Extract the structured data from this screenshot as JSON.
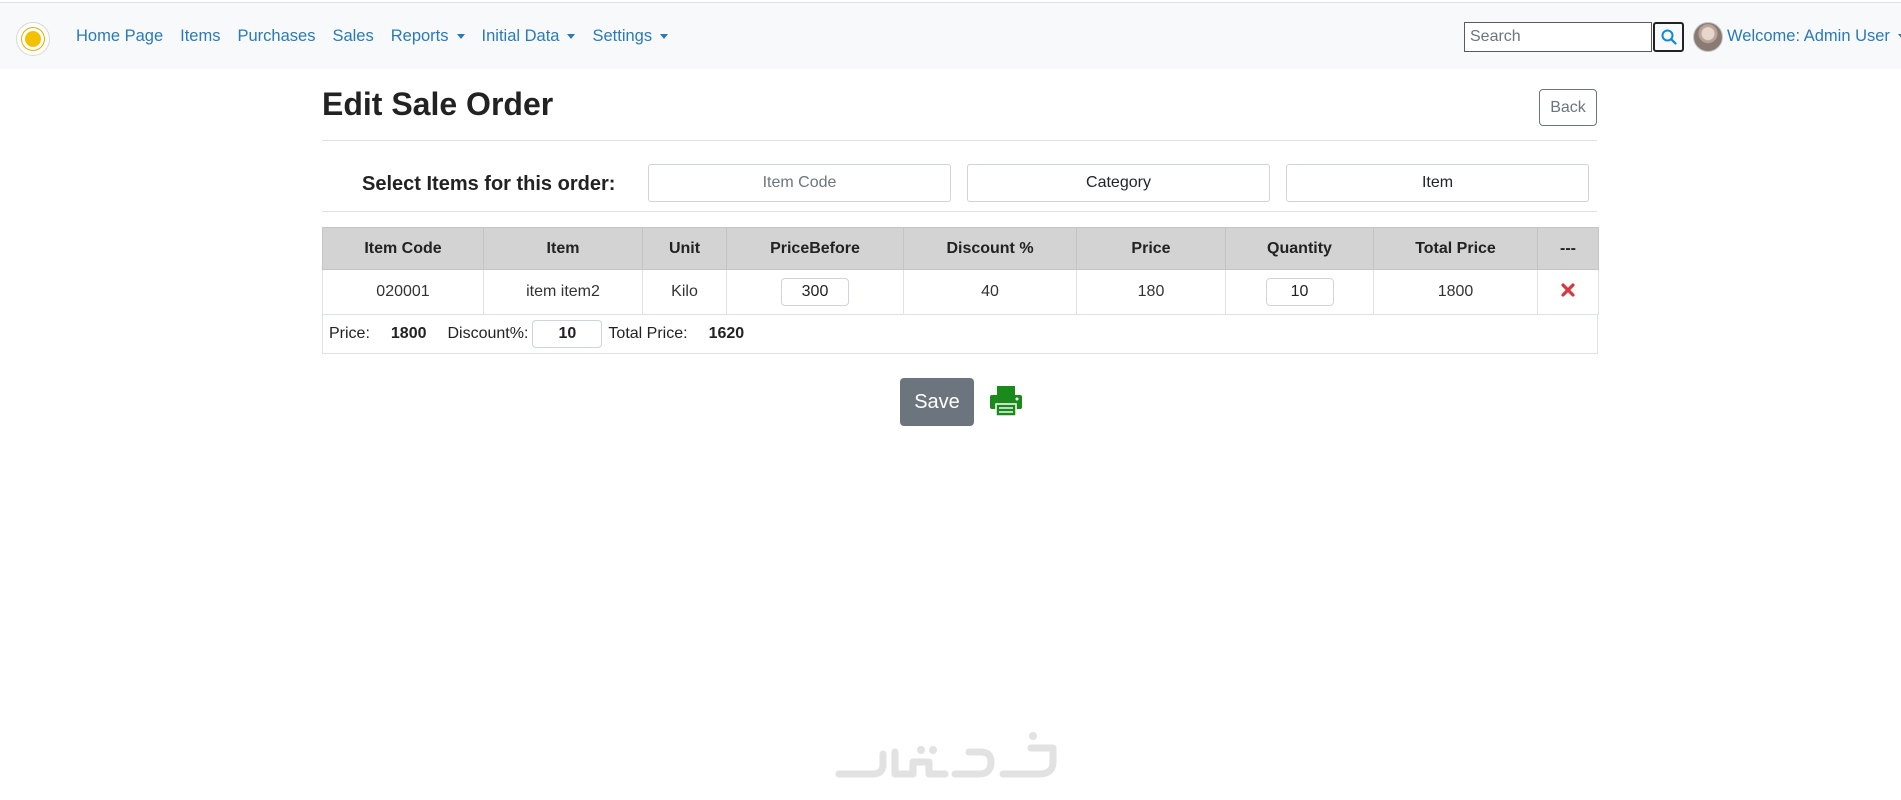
{
  "nav": {
    "links": [
      {
        "label": "Home Page",
        "dropdown": false
      },
      {
        "label": "Items",
        "dropdown": false
      },
      {
        "label": "Purchases",
        "dropdown": false
      },
      {
        "label": "Sales",
        "dropdown": false
      },
      {
        "label": "Reports",
        "dropdown": true
      },
      {
        "label": "Initial Data",
        "dropdown": true
      },
      {
        "label": "Settings",
        "dropdown": true
      }
    ],
    "search_placeholder": "Search",
    "welcome": "Welcome: Admin User"
  },
  "page": {
    "title": "Edit Sale Order",
    "back_label": "Back",
    "select_label": "Select Items for this order:",
    "item_code_placeholder": "Item Code",
    "category_label": "Category",
    "item_label": "Item"
  },
  "table": {
    "headers": [
      "Item Code",
      "Item",
      "Unit",
      "PriceBefore",
      "Discount %",
      "Price",
      "Quantity",
      "Total Price",
      "---"
    ],
    "rows": [
      {
        "item_code": "020001",
        "item": "item item2",
        "unit": "Kilo",
        "price_before": "300",
        "discount": "40",
        "price": "180",
        "quantity": "10",
        "total_price": "1800"
      }
    ]
  },
  "summary": {
    "price_label": "Price:",
    "price_value": "1800",
    "discount_label": "Discount%:",
    "discount_value": "10",
    "total_label": "Total Price:",
    "total_value": "1620"
  },
  "actions": {
    "save_label": "Save"
  },
  "colors": {
    "link": "#2a7ab8",
    "delete": "#d9363e",
    "print": "#1a8a1a",
    "save_bg": "#6c757d"
  }
}
